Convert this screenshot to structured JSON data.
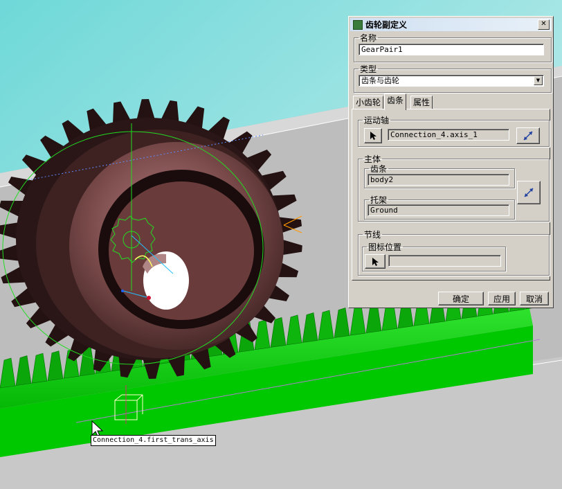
{
  "dialog": {
    "title": "齿轮副定义",
    "name_group": {
      "label": "名称",
      "value": "GearPair1"
    },
    "type_group": {
      "label": "类型",
      "selected": "齿条与齿轮"
    },
    "tabs": [
      {
        "label": "小齿轮",
        "active": false
      },
      {
        "label": "齿条",
        "active": true
      },
      {
        "label": "属性",
        "active": false
      }
    ],
    "motion_axis": {
      "label": "运动轴",
      "value": "Connection_4.axis_1"
    },
    "body_group": {
      "label": "主体",
      "rack": {
        "label": "齿条",
        "value": "body2"
      },
      "carrier": {
        "label": "托架",
        "value": "Ground"
      }
    },
    "pitch_group": {
      "label": "节线",
      "icon_position": {
        "label": "图标位置",
        "value": ""
      }
    },
    "buttons": {
      "ok": "确定",
      "apply": "应用",
      "cancel": "取消"
    }
  },
  "tooltip": "Connection_4.first_trans_axis",
  "colors": {
    "background_top": "#6fd8d8",
    "background_bottom": "#e6f6f6",
    "rack_green": "#00dd00",
    "gear_body": "#7a4a4a",
    "dialog_gray": "#d4d0c8"
  },
  "icons": [
    "select-arrow-icon",
    "flip-direction-icon",
    "dialog-app-icon",
    "close-icon",
    "mouse-cursor-icon"
  ]
}
